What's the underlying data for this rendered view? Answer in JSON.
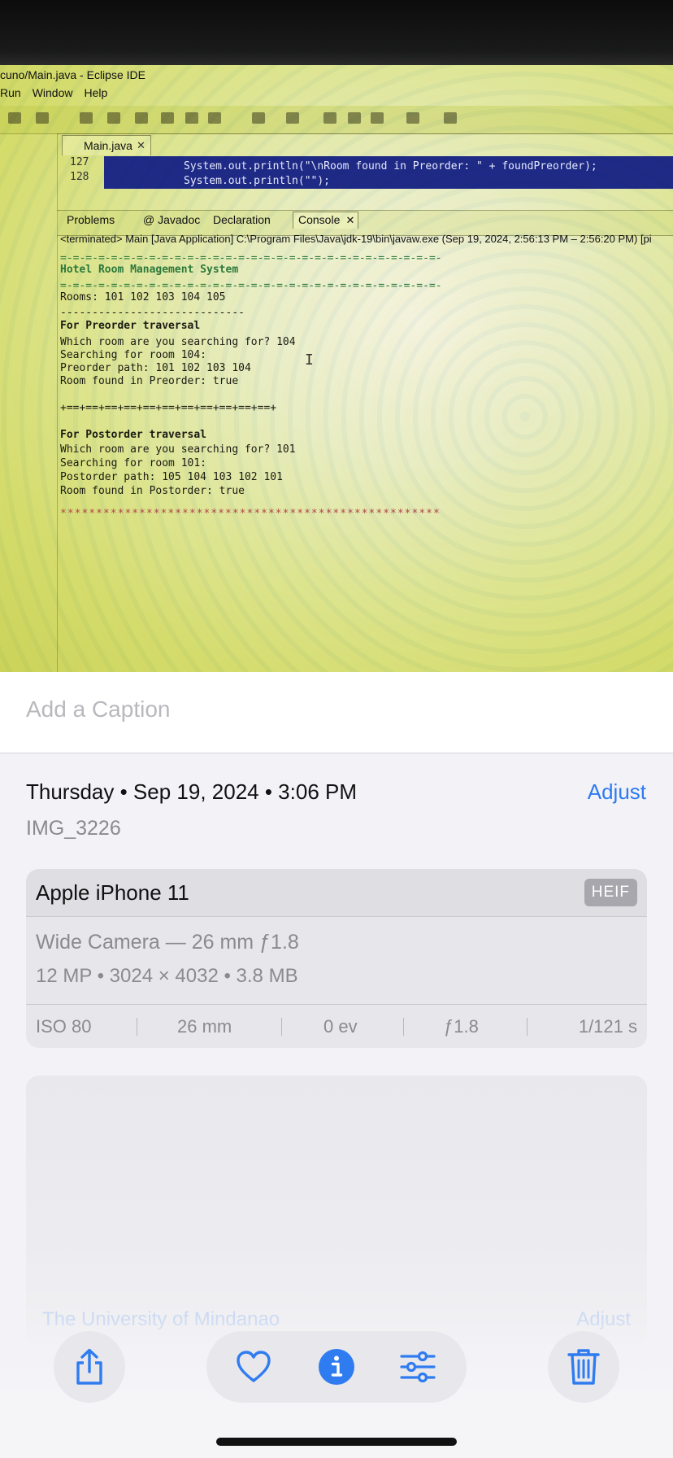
{
  "photo": {
    "window_title": "cuno/Main.java - Eclipse IDE",
    "menu": [
      "Run",
      "Window",
      "Help"
    ],
    "editor_tab": "Main.java",
    "code_lines": [
      {
        "num": "127",
        "text": "System.out.println(\"\\nRoom found in Preorder: \" + foundPreorder);"
      },
      {
        "num": "128",
        "text": "System.out.println(\"\");"
      }
    ],
    "view_tabs": [
      "Problems",
      "@ Javadoc",
      "Declaration",
      "Console"
    ],
    "console_header": "<terminated> Main [Java Application] C:\\Program Files\\Java\\jdk-19\\bin\\javaw.exe  (Sep 19, 2024, 2:56:13 PM – 2:56:20 PM) [pi",
    "console": [
      "=-=-=-=-=-=-=-=-=-=-=-=-=-=-=-=-=-=-=-=-=-=-=-=-=-=-=-=-=-=-",
      "Hotel Room Management System",
      "=-=-=-=-=-=-=-=-=-=-=-=-=-=-=-=-=-=-=-=-=-=-=-=-=-=-=-=-=-=-",
      "Rooms: 101 102 103 104 105",
      "-----------------------------",
      "For Preorder traversal",
      "Which room are you searching for? 104",
      "Searching for room 104:",
      "Preorder path: 101 102 103 104",
      "Room found in Preorder: true",
      "+==+==+==+==+==+==+==+==+==+==+==+",
      "For Postorder traversal",
      "Which room are you searching for? 101",
      "Searching for room 101:",
      "Postorder path: 105 104 103 102 101",
      "Room found in Postorder: true",
      "*****************************************************"
    ]
  },
  "caption": {
    "placeholder": "Add a Caption"
  },
  "info": {
    "date_line": "Thursday • Sep 19, 2024 • 3:06 PM",
    "adjust_label": "Adjust",
    "filename": "IMG_3226"
  },
  "device": {
    "name": "Apple iPhone 11",
    "format_badge": "HEIF",
    "lens": "Wide Camera — 26 mm ƒ1.8",
    "specs": "12 MP  •  3024 × 4032  •  3.8 MB",
    "exif": [
      "ISO 80",
      "26 mm",
      "0 ev",
      "ƒ1.8",
      "1/121 s"
    ]
  },
  "location": {
    "place": "The University of Mindanao",
    "adjust_label": "Adjust"
  },
  "toolbar": {
    "share": "share-icon",
    "favorite": "heart-icon",
    "info": "info-icon",
    "edit": "sliders-icon",
    "delete": "trash-icon",
    "accent_color": "#2f7bf0"
  }
}
